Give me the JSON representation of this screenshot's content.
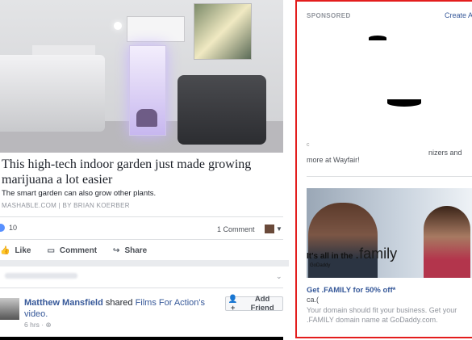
{
  "post": {
    "headline": "This high-tech indoor garden just made growing marijuana a lot easier",
    "subtext": "The smart garden can also grow other plants.",
    "source": "MASHABLE.COM | BY BRIAN KOERBER",
    "like_count": "10",
    "comment_count": "1 Comment",
    "actions": {
      "like": "Like",
      "comment": "Comment",
      "share": "Share"
    }
  },
  "shared_post": {
    "poster_name": "Matthew Mansfield",
    "verb": "shared",
    "page_name": "Films For Action",
    "object": "'s video.",
    "timestamp": "6 hrs",
    "add_friend_label": "Add Friend"
  },
  "sidebar": {
    "sponsored_label": "SPONSORED",
    "create_label": "Create A",
    "ad1": {
      "line1_right": "nizers and",
      "line2": "more at Wayfair!"
    },
    "ad2": {
      "image_tag_prefix": "It's all in the",
      "image_tag_word": ".family",
      "image_brand": "GoDaddy",
      "title": "Get .FAMILY for 50% off*",
      "domain": "ca.(",
      "description": "Your domain should fit your business. Get your .FAMILY domain name at GoDaddy.com."
    }
  },
  "colors": {
    "fb_link": "#365899",
    "ad_highlight": "#e31d1d",
    "like_blue": "#5890ff"
  }
}
